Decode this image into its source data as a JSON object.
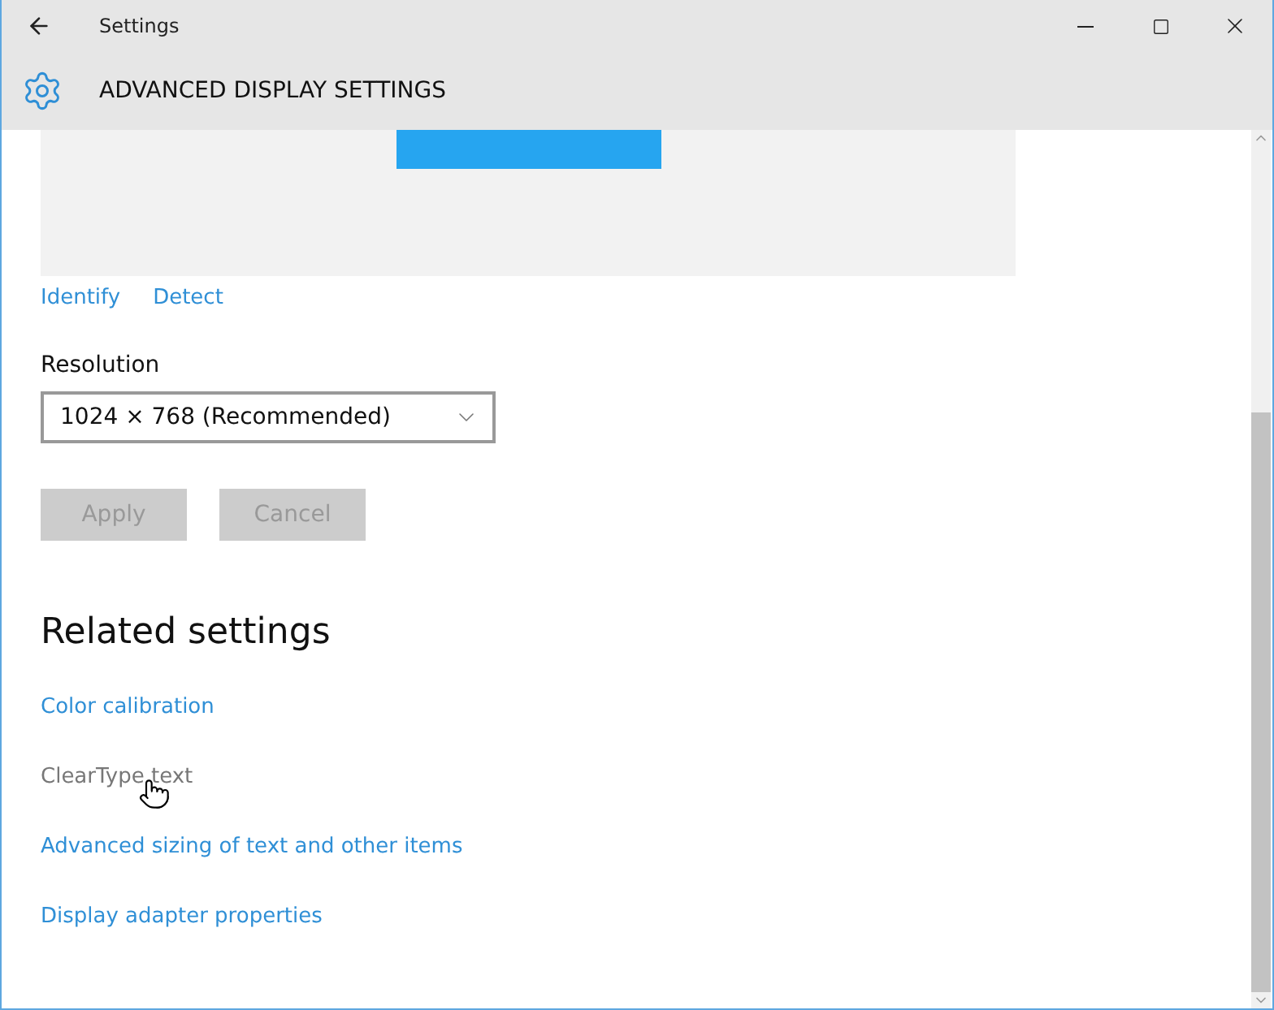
{
  "window": {
    "title": "Settings"
  },
  "header": {
    "title": "ADVANCED DISPLAY SETTINGS"
  },
  "display_links": [
    {
      "label": "Identify",
      "hovered": false
    },
    {
      "label": "Detect",
      "hovered": false
    }
  ],
  "resolution": {
    "label": "Resolution",
    "value": "1024 × 768 (Recommended)"
  },
  "buttons": [
    {
      "label": "Apply",
      "disabled": true
    },
    {
      "label": "Cancel",
      "disabled": true
    }
  ],
  "related": {
    "heading": "Related settings",
    "links": [
      {
        "label": "Color calibration",
        "hovered": false
      },
      {
        "label": "ClearType text",
        "hovered": true
      },
      {
        "label": "Advanced sizing of text and other items",
        "hovered": false
      },
      {
        "label": "Display adapter properties",
        "hovered": false
      }
    ]
  }
}
